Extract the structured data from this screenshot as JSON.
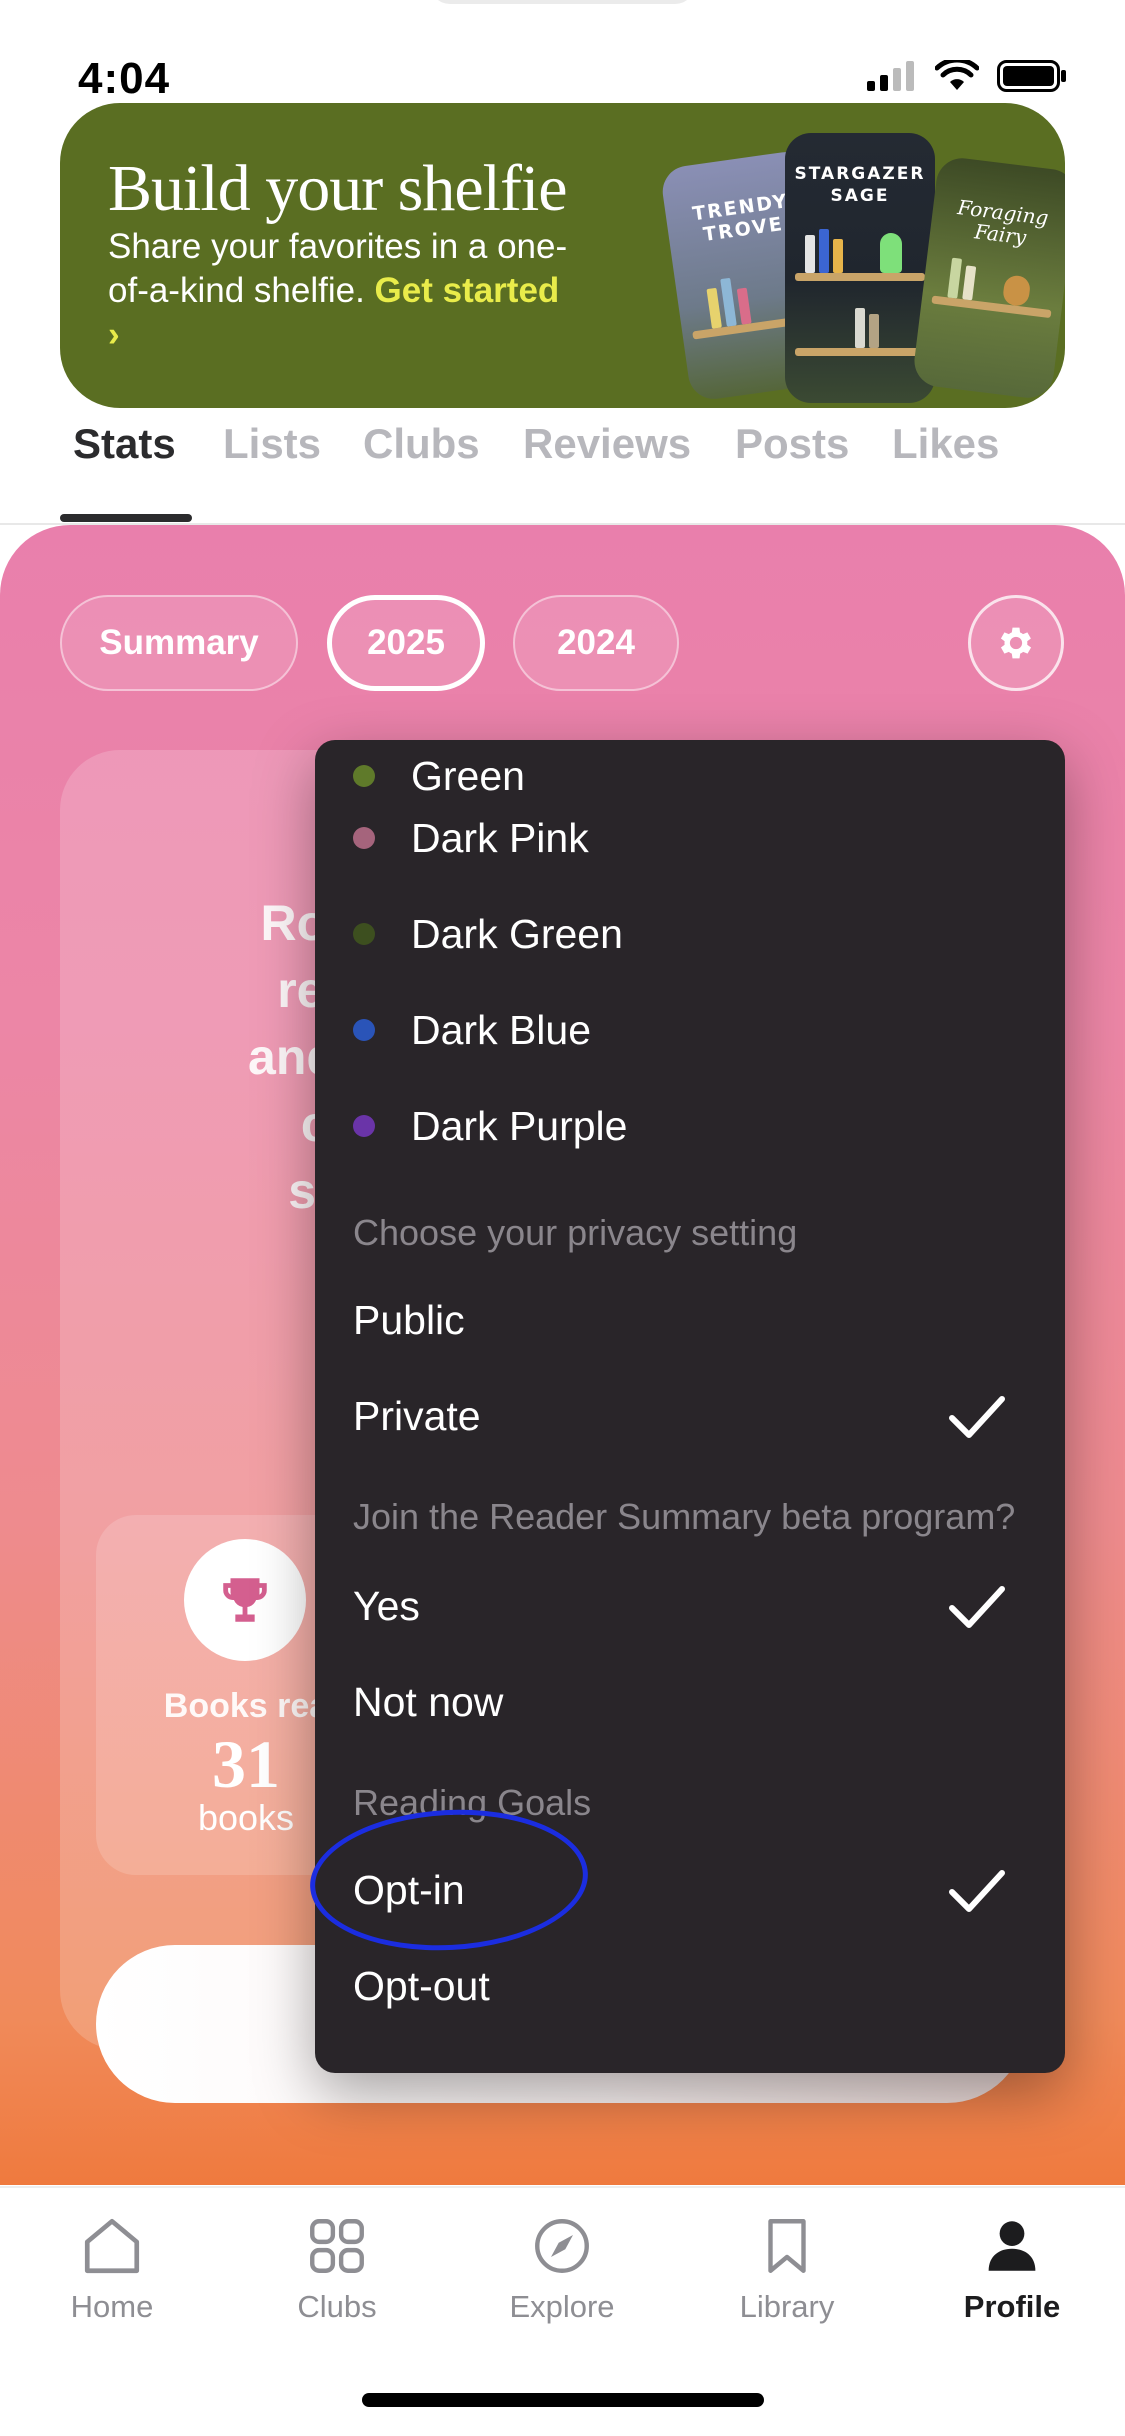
{
  "status_bar": {
    "time": "4:04"
  },
  "banner": {
    "title": "Build your shelfie",
    "text": "Share your favorites in a one-of-a-kind shelfie.",
    "link": "Get started ›",
    "cards": [
      "TRENDY TROVE",
      "STARGAZER SAGE",
      "Foraging Fairy"
    ]
  },
  "tabs": [
    {
      "label": "Stats",
      "active": true
    },
    {
      "label": "Lists"
    },
    {
      "label": "Clubs"
    },
    {
      "label": "Reviews"
    },
    {
      "label": "Posts"
    },
    {
      "label": "Likes"
    }
  ],
  "stats": {
    "pills": [
      "Summary",
      "2025",
      "2024"
    ],
    "selected_pill": "2025",
    "summary_lines": [
      "Roma",
      "read",
      "and riv",
      "ch",
      "sea"
    ],
    "tile": {
      "label": "Books rea",
      "number": "31",
      "unit": "books"
    }
  },
  "menu": {
    "colors": [
      {
        "label": "Green",
        "color": "#5f7a2a"
      },
      {
        "label": "Dark Pink",
        "color": "#a5647c"
      },
      {
        "label": "Dark Green",
        "color": "#3d4f1f"
      },
      {
        "label": "Dark Blue",
        "color": "#2a54b8"
      },
      {
        "label": "Dark Purple",
        "color": "#6a34a8"
      }
    ],
    "privacy_header": "Choose your privacy setting",
    "privacy": [
      {
        "label": "Public",
        "checked": false
      },
      {
        "label": "Private",
        "checked": true
      }
    ],
    "beta_header": "Join the Reader Summary beta program?",
    "beta": [
      {
        "label": "Yes",
        "checked": true
      },
      {
        "label": "Not now",
        "checked": false
      }
    ],
    "goals_header": "Reading Goals",
    "goals": [
      {
        "label": "Opt-in",
        "checked": true
      },
      {
        "label": "Opt-out",
        "checked": false
      }
    ]
  },
  "bottom_nav": [
    {
      "label": "Home",
      "icon": "home-icon"
    },
    {
      "label": "Clubs",
      "icon": "grid-icon"
    },
    {
      "label": "Explore",
      "icon": "compass-icon"
    },
    {
      "label": "Library",
      "icon": "bookmark-icon"
    },
    {
      "label": "Profile",
      "icon": "person-icon",
      "active": true
    }
  ],
  "colors": {
    "banner_bg": "#5a6e22",
    "menu_bg": "#292529",
    "accent_yellow": "#e9ec4a",
    "annotation": "#1b2de0"
  }
}
